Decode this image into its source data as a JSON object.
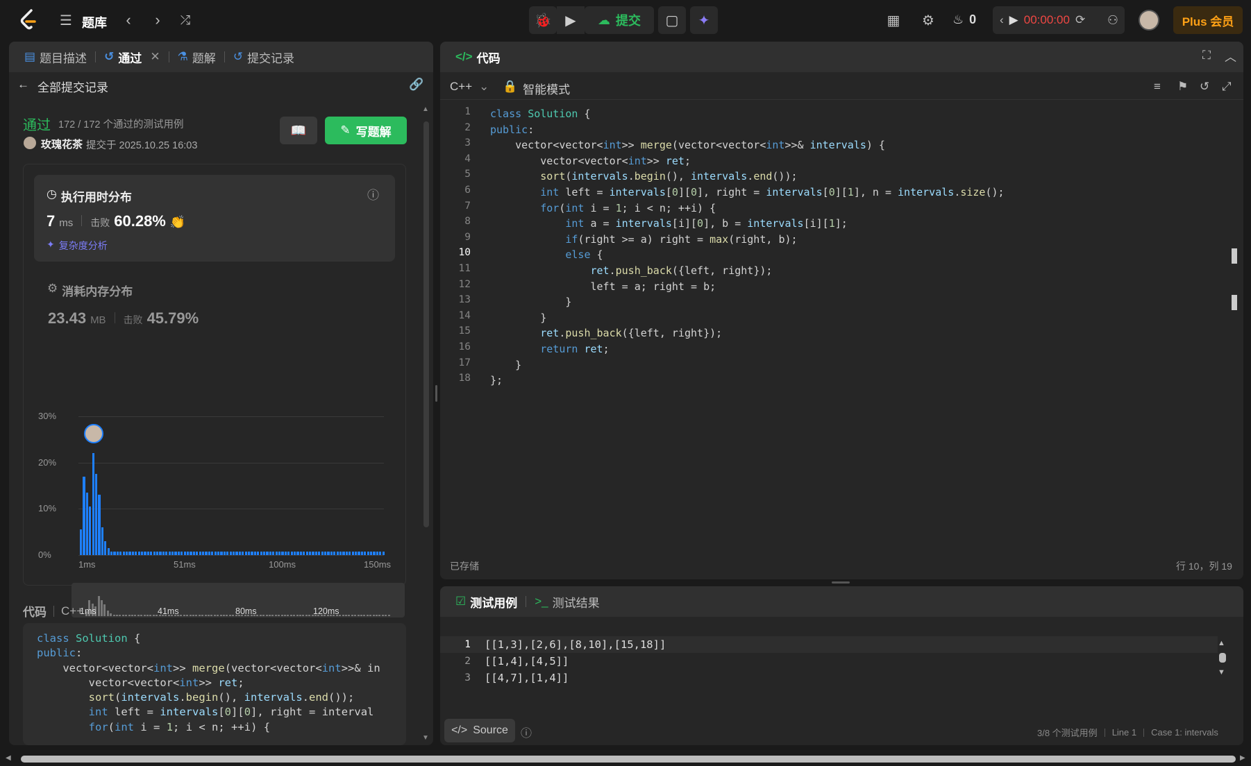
{
  "topbar": {
    "library_label": "题库",
    "submit_label": "提交",
    "streak_count": "0",
    "timer": "00:00:00",
    "plus_label": "Plus 会员"
  },
  "left": {
    "tabs": [
      {
        "label": "题目描述"
      },
      {
        "label": "通过"
      },
      {
        "label": "题解"
      },
      {
        "label": "提交记录"
      }
    ],
    "back_label": "全部提交记录",
    "status": "通过",
    "testcases": "172 / 172 个通过的测试用例",
    "user": "玫瑰花茶",
    "submitted_at": "提交于 2025.10.25 16:03",
    "write_solution": "写题解",
    "runtime": {
      "title": "执行用时分布",
      "value": "7",
      "unit": "ms",
      "beat_label": "击败",
      "beat_pct": "60.28%",
      "analysis_link": "复杂度分析"
    },
    "memory": {
      "title": "消耗内存分布",
      "value": "23.43",
      "unit": "MB",
      "beat_label": "击败",
      "beat_pct": "45.79%"
    },
    "code_header": "代码",
    "code_lang": "C++"
  },
  "chart_data": {
    "type": "bar",
    "y_ticks": [
      "30%",
      "20%",
      "10%",
      "0%"
    ],
    "x_ticks": [
      "1ms",
      "51ms",
      "100ms",
      "150ms"
    ],
    "ylim": [
      0,
      30
    ],
    "values": [
      5.5,
      17,
      13.5,
      10.5,
      22,
      17.5,
      13,
      6,
      3,
      1.5,
      0.8,
      0.8,
      0.8,
      0.8,
      0.8,
      0.8,
      0.8,
      0.8,
      0.8,
      0.8,
      0.8,
      0.8,
      0.8,
      0.8,
      0.8,
      0.8,
      0.8,
      0.8,
      0.8,
      0.8,
      0.8,
      0.8,
      0.8,
      0.8,
      0.8,
      0.8,
      0.8,
      0.8,
      0.8,
      0.8,
      0.8,
      0.8,
      0.8,
      0.8,
      0.8,
      0.8,
      0.8,
      0.8,
      0.8,
      0.8,
      0.8,
      0.8,
      0.8,
      0.8,
      0.8,
      0.8,
      0.8,
      0.8,
      0.8,
      0.8,
      0.8,
      0.8,
      0.8,
      0.8,
      0.8,
      0.8,
      0.8,
      0.8,
      0.8,
      0.8,
      0.8,
      0.8,
      0.8,
      0.8,
      0.8,
      0.8,
      0.8,
      0.8,
      0.8,
      0.8,
      0.8,
      0.8,
      0.8,
      0.8,
      0.8,
      0.8,
      0.8,
      0.8,
      0.8,
      0.8,
      0.8,
      0.8,
      0.8,
      0.8,
      0.8,
      0.8,
      0.8,
      0.8,
      0.8,
      0.8
    ],
    "highlight_index": 4,
    "mini_ticks": [
      "1ms",
      "41ms",
      "80ms",
      "120ms"
    ]
  },
  "editor": {
    "title": "代码",
    "lang": "C++",
    "mode": "智能模式",
    "saved": "已存储",
    "cursor": "行 10，列 19",
    "lines": [
      "class Solution {",
      "public:",
      "    vector<vector<int>> merge(vector<vector<int>>& intervals) {",
      "        vector<vector<int>> ret;",
      "        sort(intervals.begin(), intervals.end());",
      "        int left = intervals[0][0], right = intervals[0][1], n = intervals.size();",
      "        for(int i = 1; i < n; ++i) {",
      "            int a = intervals[i][0], b = intervals[i][1];",
      "            if(right >= a) right = max(right, b);",
      "            else {",
      "                ret.push_back({left, right});",
      "                left = a; right = b;",
      "            }",
      "        }",
      "        ret.push_back({left, right});",
      "        return ret;",
      "    }",
      "};"
    ]
  },
  "preview_lines": [
    "class Solution {",
    "public:",
    "    vector<vector<int>> merge(vector<vector<int>>& in",
    "        vector<vector<int>> ret;",
    "        sort(intervals.begin(), intervals.end());",
    "        int left = intervals[0][0], right = interval",
    "        for(int i = 1; i < n; ++i) {"
  ],
  "testcase": {
    "tab1": "测试用例",
    "tab2": "测试结果",
    "lines": [
      "[[1,3],[2,6],[8,10],[15,18]]",
      "[[1,4],[4,5]]",
      "[[4,7],[1,4]]"
    ],
    "source_label": "Source",
    "status_count": "3/8 个测试用例",
    "status_line": "Line 1",
    "status_case": "Case 1: intervals"
  }
}
